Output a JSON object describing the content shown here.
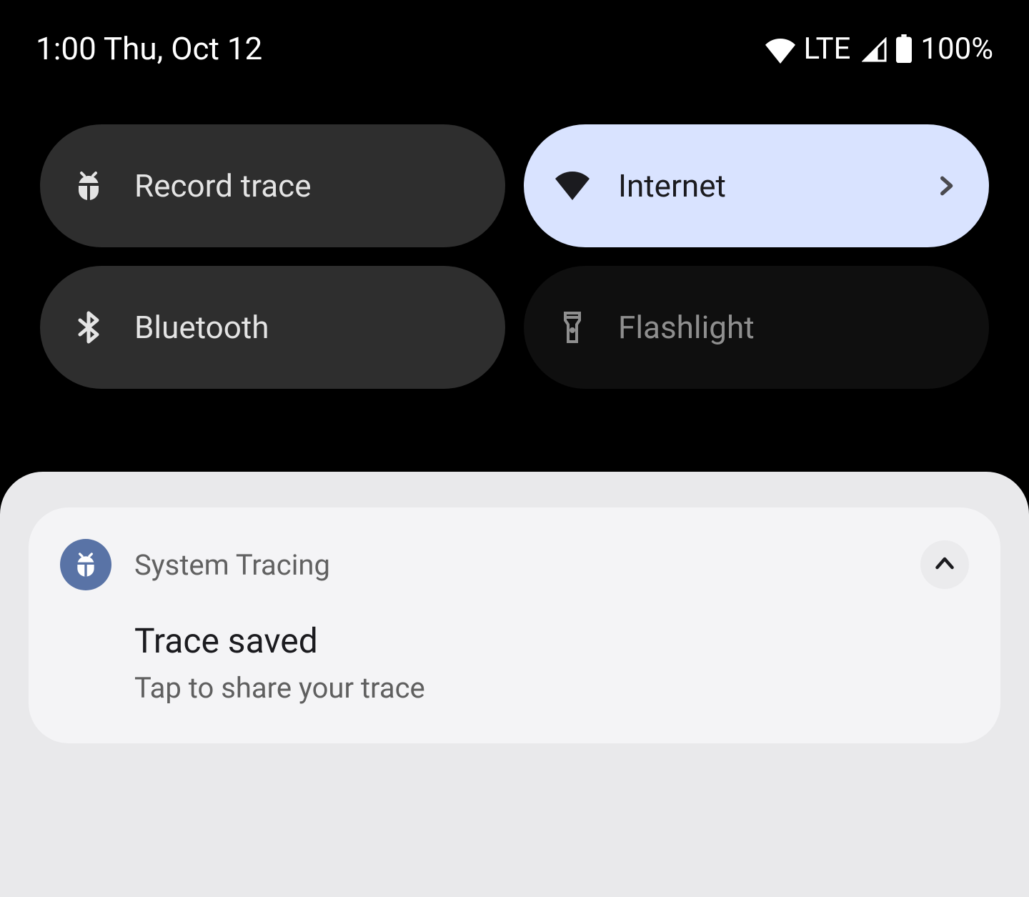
{
  "statusbar": {
    "time_date": "1:00 Thu, Oct 12",
    "network_label": "LTE",
    "battery_text": "100%"
  },
  "tiles": {
    "record_trace": {
      "label": "Record trace"
    },
    "internet": {
      "label": "Internet"
    },
    "bluetooth": {
      "label": "Bluetooth"
    },
    "flashlight": {
      "label": "Flashlight"
    }
  },
  "notification": {
    "app_name": "System Tracing",
    "title": "Trace saved",
    "subtitle": "Tap to share your trace"
  }
}
